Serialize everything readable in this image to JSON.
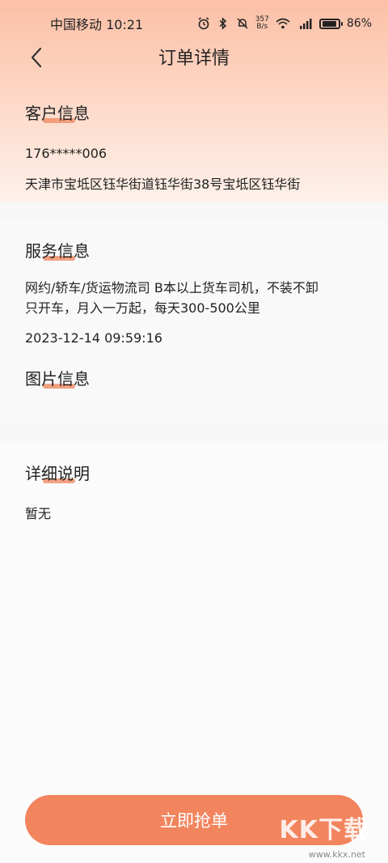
{
  "status_bar": {
    "carrier_time": "中国移动 10:21",
    "speed_top": "357",
    "speed_bottom": "B/s",
    "battery": "86%"
  },
  "nav": {
    "title": "订单详情"
  },
  "customer": {
    "title": "客户信息",
    "phone": "176*****006",
    "address": "天津市宝坻区钰华街道钰华街38号宝坻区钰华街"
  },
  "service": {
    "title": "服务信息",
    "desc_line1": "网约/轿车/货运物流司  B本以上货车司机，不装不卸",
    "desc_line2": "只开车，月入一万起，每天300-500公里",
    "datetime": "2023-12-14 09:59:16",
    "images_title": "图片信息"
  },
  "detail": {
    "title": "详细说明",
    "content": "暂无"
  },
  "actions": {
    "grab_label": "立即抢单"
  },
  "watermark": {
    "logo_text": "KK下载",
    "url": "www.kkx.net"
  },
  "colors": {
    "accent": "#f2845e",
    "underline": "#f0906c",
    "header_gradient_top": "#fcc0a6"
  }
}
